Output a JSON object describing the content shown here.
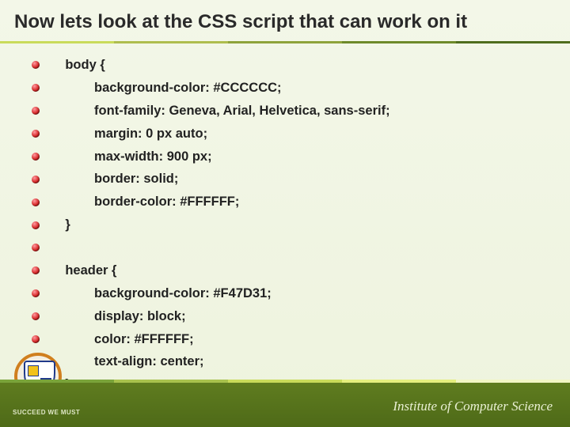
{
  "title": "Now lets look at the CSS script that can work on it",
  "code_lines": [
    {
      "text": " body {",
      "indent": 1
    },
    {
      "text": "background-color: #CCCCCC;",
      "indent": 2
    },
    {
      "text": "font-family: Geneva, Arial, Helvetica, sans-serif;",
      "indent": 2
    },
    {
      "text": "margin: 0 px auto;",
      "indent": 2
    },
    {
      "text": "max-width: 900 px;",
      "indent": 2
    },
    {
      "text": "border: solid;",
      "indent": 2
    },
    {
      "text": "border-color: #FFFFFF;",
      "indent": 2
    },
    {
      "text": "}",
      "indent": 1
    },
    {
      "text": "",
      "indent": 1
    },
    {
      "text": "header {",
      "indent": 1
    },
    {
      "text": "background-color: #F47D31;",
      "indent": 2
    },
    {
      "text": "display: block;",
      "indent": 2
    },
    {
      "text": "color: #FFFFFF;",
      "indent": 2
    },
    {
      "text": "text-align: center;",
      "indent": 2
    },
    {
      "text": "}",
      "indent": 1
    }
  ],
  "footer": {
    "motto": "SUCCEED WE MUST",
    "department_prefix": "Institute ",
    "department_of": "of ",
    "department_name": "Computer Science"
  }
}
